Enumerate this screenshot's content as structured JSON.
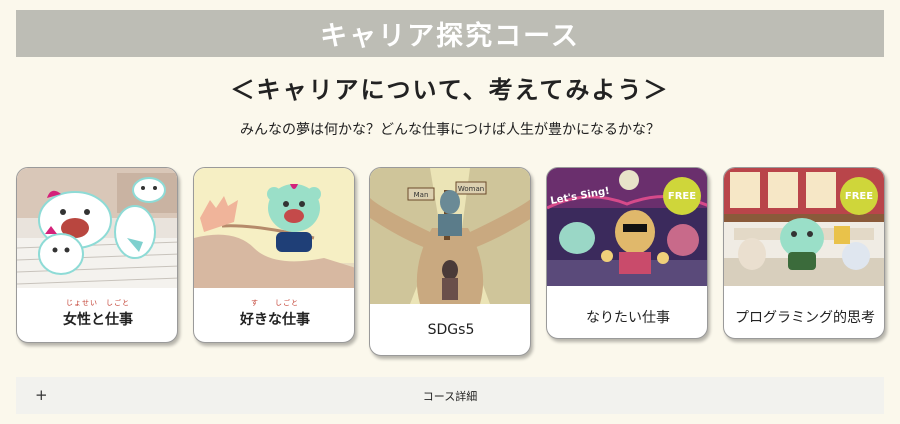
{
  "header": {
    "title": "キャリア探究コース"
  },
  "intro": {
    "subtitle": "＜キャリアについて、考えてみよう＞",
    "lead": "みんなの夢は何かな？どんな仕事につけば人生が豊かになるかな？"
  },
  "cards": [
    {
      "label": "女性と仕事",
      "ruby": "じょせい　しごと",
      "free": false
    },
    {
      "label": "好きな仕事",
      "ruby": "す　　しごと",
      "free": false
    },
    {
      "label": "SDGs5",
      "free": false
    },
    {
      "label": "なりたい仕事",
      "free": true,
      "badge": "FREE"
    },
    {
      "label": "プログラミング的思考",
      "free": true,
      "badge": "FREE"
    }
  ],
  "illustration_text": {
    "sign_left": "Man",
    "sign_right": "Woman",
    "lets_sing": "Let's Sing!"
  },
  "details": {
    "icon": "plus-icon",
    "label": "コース詳細"
  },
  "colors": {
    "background": "#fbf8ec",
    "header": "#bdbdb5",
    "badge": "#cfd63a"
  }
}
